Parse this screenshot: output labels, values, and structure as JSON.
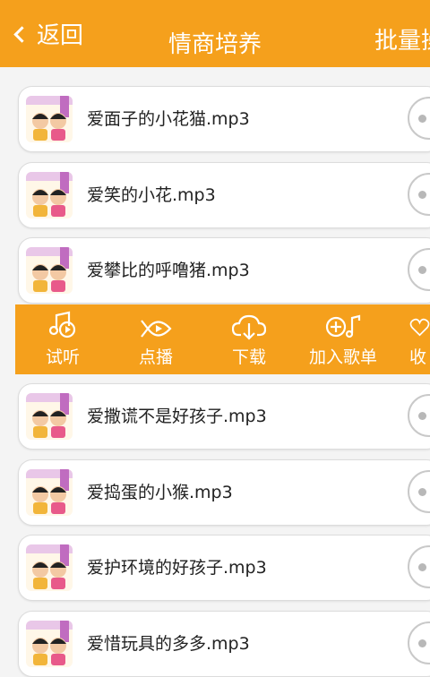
{
  "header": {
    "back_label": "返回",
    "title": "情商培养",
    "batch_label": "批量操"
  },
  "tracks": [
    {
      "name": "爱面子的小花猫.mp3"
    },
    {
      "name": "爱笑的小花.mp3"
    },
    {
      "name": "爱攀比的呼噜猪.mp3"
    },
    {
      "name": "爱撒谎不是好孩子.mp3"
    },
    {
      "name": "爱捣蛋的小猴.mp3"
    },
    {
      "name": "爱护环境的好孩子.mp3"
    },
    {
      "name": "爱惜玩具的多多.mp3"
    }
  ],
  "actions": [
    {
      "label": "试听",
      "icon": "music-note-play-icon"
    },
    {
      "label": "点播",
      "icon": "fish-play-icon"
    },
    {
      "label": "下载",
      "icon": "cloud-download-icon"
    },
    {
      "label": "加入歌单",
      "icon": "add-to-playlist-icon"
    },
    {
      "label": "收",
      "icon": "favorite-icon"
    }
  ],
  "colors": {
    "accent": "#f5a01c"
  }
}
